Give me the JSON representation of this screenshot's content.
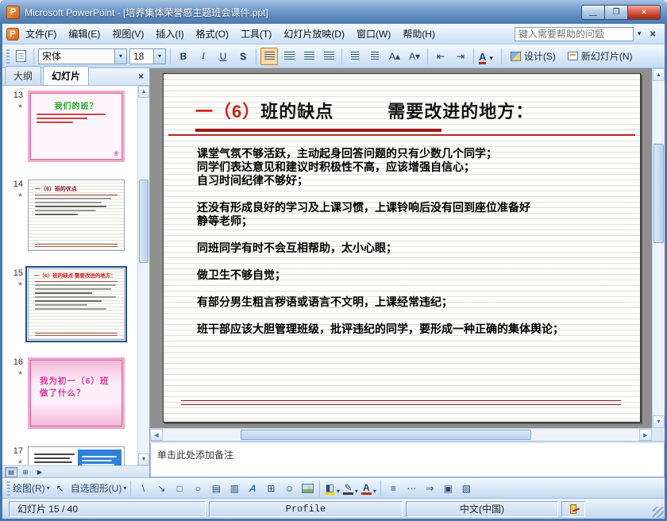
{
  "window": {
    "title": "Microsoft PowerPoint - [培养集体荣誉感主题班会课件.ppt]"
  },
  "menu": {
    "items": [
      "文件(F)",
      "编辑(E)",
      "视图(V)",
      "插入(I)",
      "格式(O)",
      "工具(T)",
      "幻灯片放映(D)",
      "窗口(W)",
      "帮助(H)"
    ],
    "help_placeholder": "键入需要帮助的问题"
  },
  "toolbar": {
    "font_name": "宋体",
    "font_size": "18",
    "bold": "B",
    "italic": "I",
    "underline": "U",
    "shadow": "S",
    "font_color_letter": "A",
    "design": "设计(S)",
    "new_slide": "新幻灯片(N)"
  },
  "tabs": {
    "outline": "大纲",
    "slides": "幻灯片"
  },
  "thumbnails": [
    {
      "number": "13",
      "title": "我们的班？"
    },
    {
      "number": "14",
      "title": "一（6）班的优点"
    },
    {
      "number": "15",
      "title": "一（6）班的缺点  需要改进的地方："
    },
    {
      "number": "16",
      "title": "我为初一（6）班做了什么？"
    },
    {
      "number": "17",
      "title": ""
    }
  ],
  "slide": {
    "title_red": "一（6）",
    "title_black": "班的缺点",
    "title_right": "需要改进的地方：",
    "body_lines": [
      "课堂气氛不够活跃，主动起身回答问题的只有少数几个同学；",
      "同学们表达意见和建议时积极性不高，应该增强自信心；",
      "自习时间纪律不够好；",
      "",
      "还没有形成良好的学习及上课习惯，上课铃响后没有回到座位准备好",
      "静等老师；",
      "",
      "同班同学有时不会互相帮助，太小心眼；",
      "",
      "做卫生不够自觉；",
      "",
      "有部分男生粗言秽语或语言不文明，上课经常违纪；",
      "",
      "班干部应该大胆管理班级，批评违纪的同学，要形成一种正确的集体舆论；"
    ]
  },
  "notes": {
    "placeholder": "单击此处添加备注"
  },
  "drawbar": {
    "draw": "绘图(R)",
    "autoshapes": "自选图形(U)"
  },
  "statusbar": {
    "slide_indicator": "幻灯片 15 / 40",
    "template": "Profile",
    "language": "中文(中国)"
  },
  "colors": {
    "title_red": "#cc2211",
    "rule_red": "#9e1b1b",
    "selection_blue": "#1b4c92",
    "close_button_red": "#c03a22"
  },
  "icons": {
    "ppt_letter": "P",
    "minimize": "—",
    "maximize": "❐",
    "close_x": "×",
    "chevron_down": "▾",
    "scroll_up": "▲",
    "scroll_down": "▼",
    "scroll_left": "◀",
    "scroll_right": "▶",
    "anim_star": "★",
    "flower": "❀",
    "select_arrow": "↖",
    "line": "\\",
    "arrow": "↘",
    "rectangle": "□",
    "oval": "○",
    "text_box": "▤",
    "vertical_text_box": "▥",
    "wordart": "A",
    "diagram": "⊞",
    "clip_art": "☺",
    "fill": "◧",
    "brush": "✎",
    "font_a": "A",
    "grow_font": "A▴",
    "shrink_font": "A▾",
    "indent_less": "⇤",
    "indent_more": "⇥",
    "line_style": "≡",
    "dash_style": "⋯",
    "arrow_style": "⇒",
    "shadow_style": "▣",
    "threed_style": "▧",
    "view_normal": "▤",
    "view_sorter": "⊞",
    "view_show": "▶"
  }
}
